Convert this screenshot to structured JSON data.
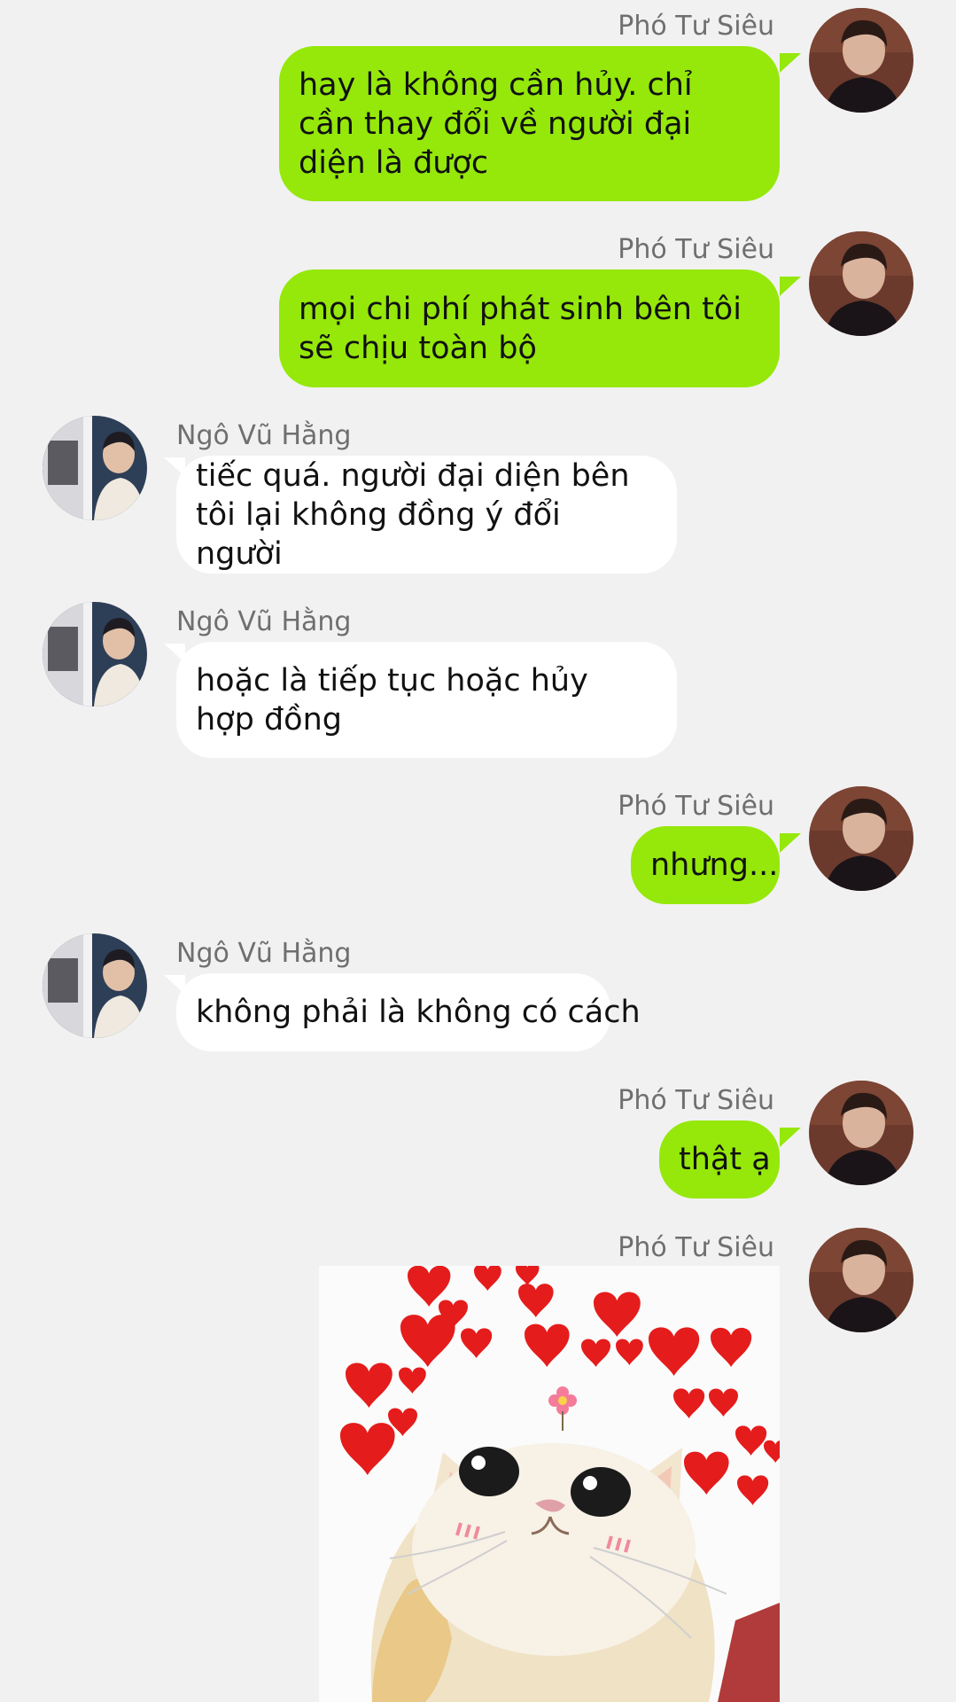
{
  "participants": {
    "me": "Phó Tư Siêu",
    "other": "Ngô Vũ Hằng"
  },
  "colors": {
    "background": "#f1f1f1",
    "outgoing_bubble": "#95e80a",
    "incoming_bubble": "#ffffff",
    "name_text": "#6f6f6f"
  },
  "messages": [
    {
      "sender": "Phó Tư Siêu",
      "text": "hay là không cần hủy. chỉ cần thay đổi về người đại diện là được"
    },
    {
      "sender": "Phó Tư Siêu",
      "text": "mọi chi phí phát sinh bên tôi sẽ chịu toàn bộ"
    },
    {
      "sender": "Ngô Vũ Hằng",
      "text": "tiếc quá. người đại diện bên tôi lại không đồng ý đổi người"
    },
    {
      "sender": "Ngô Vũ Hằng",
      "text": "hoặc là tiếp tục hoặc hủy hợp đồng"
    },
    {
      "sender": "Phó Tư Siêu",
      "text": "nhưng..."
    },
    {
      "sender": "Ngô Vũ Hằng",
      "text": "không phải là không có cách"
    },
    {
      "sender": "Phó Tư Siêu",
      "text": "thật ạ"
    },
    {
      "sender": "Phó Tư Siêu",
      "sticker": "cat-with-hearts-sticker"
    }
  ]
}
